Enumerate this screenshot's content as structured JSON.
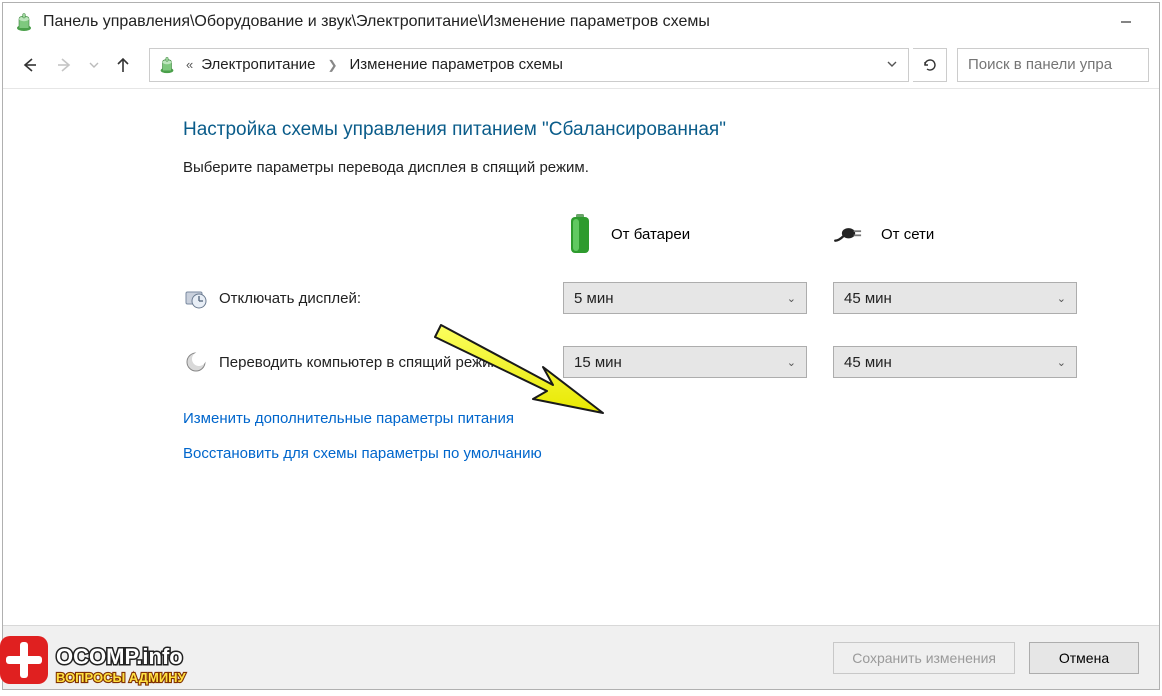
{
  "titlebar": {
    "title": "Панель управления\\Оборудование и звук\\Электропитание\\Изменение параметров схемы"
  },
  "breadcrumb": {
    "item1": "Электропитание",
    "item2": "Изменение параметров схемы"
  },
  "search": {
    "placeholder": "Поиск в панели упра"
  },
  "page": {
    "title": "Настройка схемы управления питанием \"Сбалансированная\"",
    "subtitle": "Выберите параметры перевода дисплея в спящий режим."
  },
  "columns": {
    "battery": "От батареи",
    "plugged": "От сети"
  },
  "settings": {
    "display_off": {
      "label": "Отключать дисплей:",
      "battery": "5 мин",
      "plugged": "45 мин"
    },
    "sleep": {
      "label": "Переводить компьютер в спящий режим:",
      "battery": "15 мин",
      "plugged": "45 мин"
    }
  },
  "links": {
    "advanced": "Изменить дополнительные параметры питания",
    "restore": "Восстановить для схемы параметры по умолчанию"
  },
  "footer": {
    "save": "Сохранить изменения",
    "cancel": "Отмена"
  },
  "watermark": {
    "line1": "OCOMP.info",
    "line2": "ВОПРОСЫ АДМИНУ"
  }
}
